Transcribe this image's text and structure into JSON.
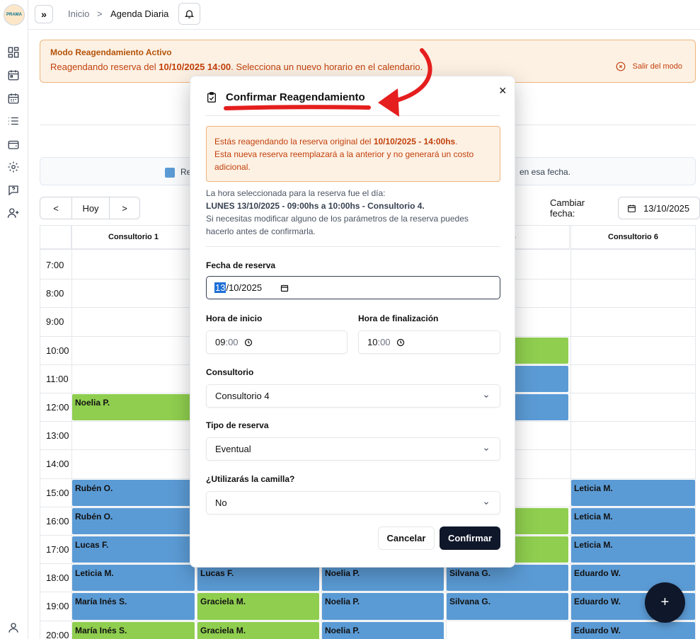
{
  "app": {
    "logo_text": "PRAMA"
  },
  "topbar": {
    "breadcrumb_home": "Inicio",
    "breadcrumb_sep": ">",
    "breadcrumb_current": "Agenda Diaria"
  },
  "banner": {
    "title": "Modo Reagendamiento Activo",
    "text_prefix": "Reagendando reserva del ",
    "text_bold": "10/10/2025 14:00",
    "text_suffix": ". Selecciona un nuevo horario en el calendario.",
    "exit_label": "Salir del modo"
  },
  "legend": {
    "left_text": "Re",
    "right_text": "en esa fecha."
  },
  "nav": {
    "prev": "<",
    "today": "Hoy",
    "next": ">"
  },
  "date_control": {
    "label": "Cambiar fecha:",
    "value": "13/10/2025"
  },
  "calendar": {
    "columns": [
      "Consultorio 1",
      "",
      "",
      "rio 5",
      "Consultorio 6"
    ],
    "times": [
      "7:00",
      "8:00",
      "9:00",
      "10:00",
      "11:00",
      "12:00",
      "13:00",
      "14:00",
      "15:00",
      "16:00",
      "17:00",
      "18:00",
      "19:00",
      "20:00"
    ],
    "events": [
      {
        "name": "Noelia P.",
        "col": 0,
        "row": 5,
        "color": "g"
      },
      {
        "name": "Rubén O.",
        "col": 0,
        "row": 8,
        "color": "b"
      },
      {
        "name": "Rubén O.",
        "col": 0,
        "row": 9,
        "color": "b"
      },
      {
        "name": "Lucas F.",
        "col": 0,
        "row": 10,
        "color": "b"
      },
      {
        "name": "Leticia M.",
        "col": 0,
        "row": 11,
        "color": "b"
      },
      {
        "name": "María Inés S.",
        "col": 0,
        "row": 12,
        "color": "b"
      },
      {
        "name": "María Inés S.",
        "col": 0,
        "row": 13,
        "color": "g"
      },
      {
        "name": "Lucas F.",
        "col": 1,
        "row": 11,
        "color": "b"
      },
      {
        "name": "Graciela M.",
        "col": 1,
        "row": 12,
        "color": "g"
      },
      {
        "name": "Graciela M.",
        "col": 1,
        "row": 13,
        "color": "g"
      },
      {
        "name": "Noelia P.",
        "col": 2,
        "row": 11,
        "color": "b"
      },
      {
        "name": "Noelia P.",
        "col": 2,
        "row": 12,
        "color": "b"
      },
      {
        "name": "Noelia P.",
        "col": 2,
        "row": 13,
        "color": "b"
      },
      {
        "name": "",
        "col": 3,
        "row": 3,
        "color": "g"
      },
      {
        "name": "",
        "col": 3,
        "row": 4,
        "color": "b"
      },
      {
        "name": "",
        "col": 3,
        "row": 5,
        "color": "b"
      },
      {
        "name": "",
        "col": 3,
        "row": 9,
        "color": "g"
      },
      {
        "name": "",
        "col": 3,
        "row": 10,
        "color": "g"
      },
      {
        "name": "Silvana G.",
        "col": 3,
        "row": 11,
        "color": "b"
      },
      {
        "name": "Silvana G.",
        "col": 3,
        "row": 12,
        "color": "b"
      },
      {
        "name": "Leticia M.",
        "col": 4,
        "row": 8,
        "color": "b"
      },
      {
        "name": "Leticia M.",
        "col": 4,
        "row": 9,
        "color": "b"
      },
      {
        "name": "Leticia M.",
        "col": 4,
        "row": 10,
        "color": "b"
      },
      {
        "name": "Eduardo W.",
        "col": 4,
        "row": 11,
        "color": "b"
      },
      {
        "name": "Eduardo W.",
        "col": 4,
        "row": 12,
        "color": "b"
      },
      {
        "name": "Eduardo W.",
        "col": 4,
        "row": 13,
        "color": "b"
      }
    ]
  },
  "fab": {
    "label": "+"
  },
  "modal": {
    "title": "Confirmar Reagendamiento",
    "close": "×",
    "warn_l1_prefix": "Estás reagendando la reserva original del ",
    "warn_l1_bold": "10/10/2025 - 14:00hs",
    "warn_l1_suffix": ".",
    "warn_l2": "Esta nueva reserva reemplazará a la anterior y no generará un costo",
    "warn_l3": "adicional.",
    "info_l1": "La hora seleccionada para la reserva fue el día:",
    "info_l2": "LUNES 13/10/2025 - 09:00hs a 10:00hs - Consultorio 4.",
    "info_l3": "Si necesitas modificar alguno de los parámetros de la reserva puedes",
    "info_l4": "hacerlo antes de confirmarla.",
    "fecha_label": "Fecha de reserva",
    "fecha_day": "13",
    "fecha_rest": "/10/2025",
    "inicio_label": "Hora de inicio",
    "inicio_hour": "09",
    "inicio_min": ":00",
    "fin_label": "Hora de finalización",
    "fin_hour": "10",
    "fin_min": ":00",
    "consultorio_label": "Consultorio",
    "consultorio_value": "Consultorio 4",
    "tipo_label": "Tipo de reserva",
    "tipo_value": "Eventual",
    "camilla_label": "¿Utilizarás la camilla?",
    "camilla_value": "No",
    "cancel": "Cancelar",
    "confirm": "Confirmar"
  },
  "colors": {
    "accent_red": "#e51e1e",
    "warn_text": "#c2410c",
    "event_blue": "#5b9bd5",
    "event_green": "#8fce4f",
    "dark": "#0f172a"
  }
}
